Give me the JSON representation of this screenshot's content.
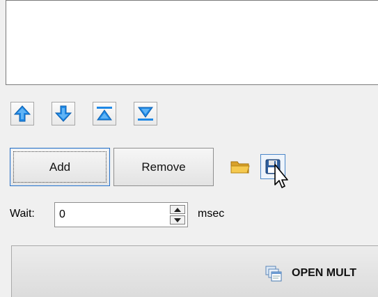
{
  "list": {
    "items": []
  },
  "toolbar": {
    "move_up_icon": "arrow-up-icon",
    "move_down_icon": "arrow-down-icon",
    "move_top_icon": "move-to-top-icon",
    "move_bottom_icon": "move-to-bottom-icon"
  },
  "buttons": {
    "add_label": "Add",
    "remove_label": "Remove",
    "open_icon": "folder-icon",
    "save_icon": "floppy-disk-icon"
  },
  "wait": {
    "label": "Wait:",
    "value": "0",
    "unit": "msec"
  },
  "open_panel": {
    "label": "OPEN MULT",
    "icon": "windows-stack-icon"
  },
  "colors": {
    "arrow_blue": "#1e88e5",
    "focus_border": "#2a6fc2"
  }
}
